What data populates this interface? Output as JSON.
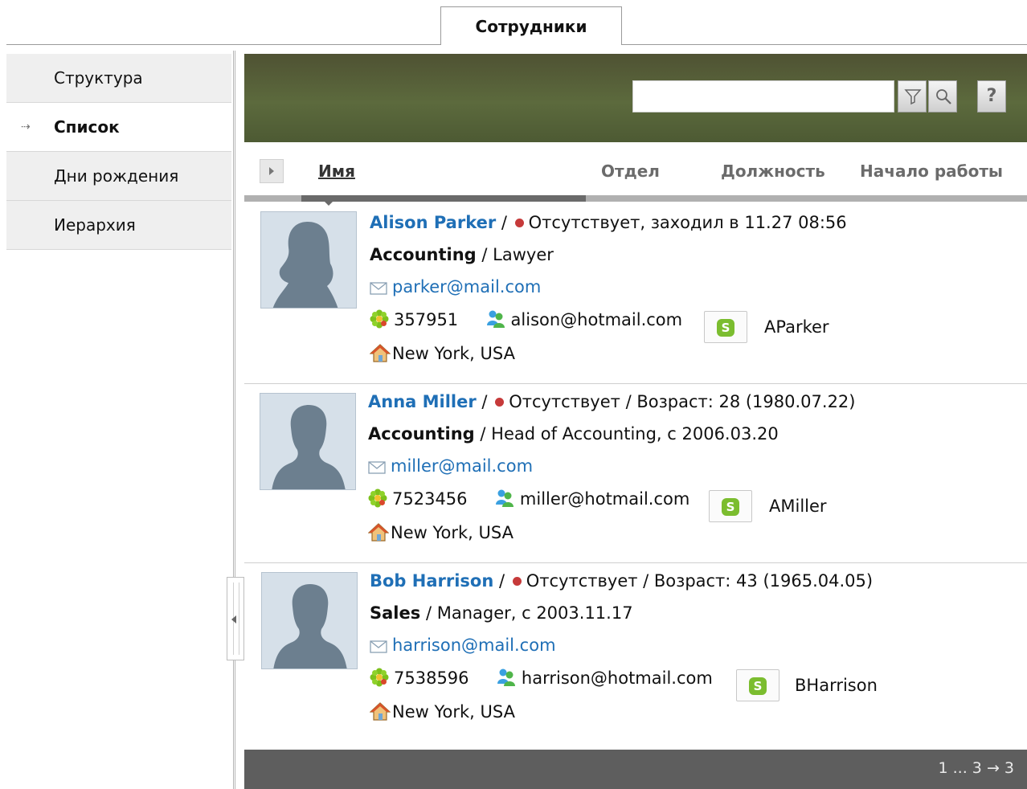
{
  "tab": {
    "label": "Сотрудники"
  },
  "sidebar": {
    "items": [
      {
        "label": "Структура",
        "active": false
      },
      {
        "label": "Список",
        "active": true
      },
      {
        "label": "Дни рождения",
        "active": false
      },
      {
        "label": "Иерархия",
        "active": false
      }
    ],
    "active_arrow": "⇢"
  },
  "toolbar": {
    "search_value": "",
    "help_label": "?"
  },
  "columns": {
    "name": "Имя",
    "department": "Отдел",
    "position": "Должность",
    "start": "Начало работы"
  },
  "employees": [
    {
      "name": "Alison Parker",
      "status": "Отсутствует, заходил в 11.27 08:56",
      "department": "Accounting",
      "position": "Lawyer",
      "email": "parker@mail.com",
      "icq": "357951",
      "msn": "alison@hotmail.com",
      "skype": "AParker",
      "location": "New York, USA"
    },
    {
      "name": "Anna Miller",
      "status": "Отсутствует / Возраст: 28 (1980.07.22)",
      "department": "Accounting",
      "position": "Head of Accounting, с 2006.03.20",
      "email": "miller@mail.com",
      "icq": "7523456",
      "msn": "miller@hotmail.com",
      "skype": "AMiller",
      "location": "New York, USA"
    },
    {
      "name": "Bob Harrison",
      "status": "Отсутствует / Возраст: 43 (1965.04.05)",
      "department": "Sales",
      "position": "Manager, с 2003.11.17",
      "email": "harrison@mail.com",
      "icq": "7538596",
      "msn": "harrison@hotmail.com",
      "skype": "BHarrison",
      "location": "New York, USA"
    }
  ],
  "separator": "/",
  "pager": {
    "text": "1 ... 3",
    "arrow": "→",
    "last": "3"
  },
  "colors": {
    "link": "#1f6fb6",
    "toolbar": "#5c6a3d",
    "status_away": "#c63a3a",
    "footer": "#5e5e5e"
  }
}
